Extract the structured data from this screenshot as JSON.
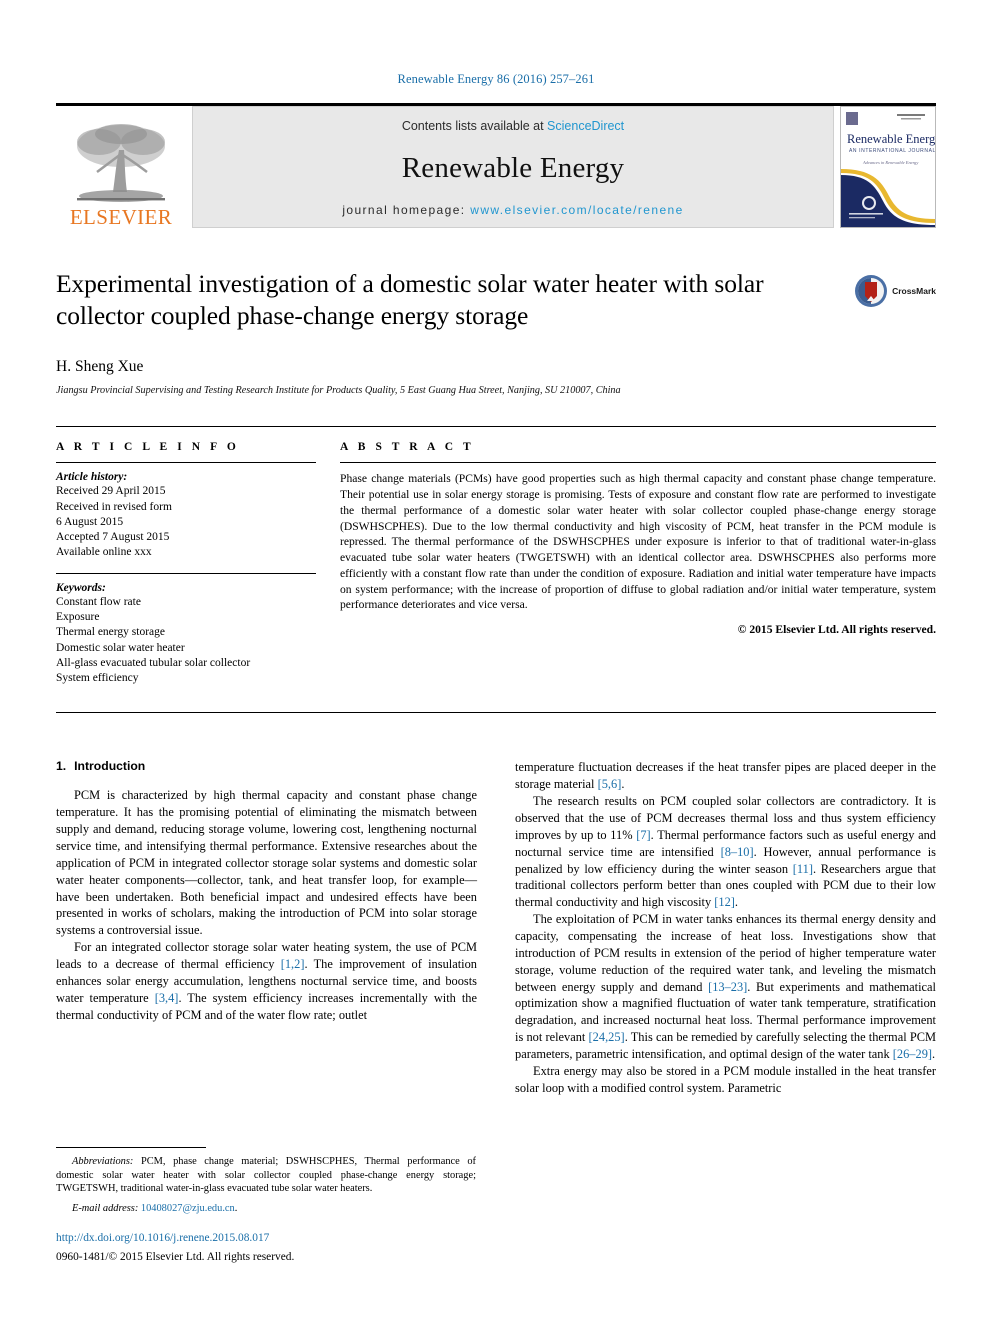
{
  "running_head": "Renewable Energy 86 (2016) 257–261",
  "masthead": {
    "publisher_name": "ELSEVIER",
    "contents_prefix": "Contents lists available at ",
    "contents_link": "ScienceDirect",
    "journal_name": "Renewable Energy",
    "homepage_prefix": "journal homepage: ",
    "homepage_url": "www.elsevier.com/locate/renene",
    "cover_title": "Renewable Energy",
    "cover_subtitle": "AN INTERNATIONAL JOURNAL"
  },
  "article": {
    "title": "Experimental investigation of a domestic solar water heater with solar collector coupled phase-change energy storage",
    "authors": "H. Sheng Xue",
    "affiliation": "Jiangsu Provincial Supervising and Testing Research Institute for Products Quality, 5 East Guang Hua Street, Nanjing, SU 210007, China",
    "crossmark_label": "CrossMark"
  },
  "article_info": {
    "heading": "A R T I C L E  I N F O",
    "history_label": "Article history:",
    "history_lines": [
      "Received 29 April 2015",
      "Received in revised form",
      "6 August 2015",
      "Accepted 7 August 2015",
      "Available online xxx"
    ],
    "keywords_label": "Keywords:",
    "keywords": [
      "Constant flow rate",
      "Exposure",
      "Thermal energy storage",
      "Domestic solar water heater",
      "All-glass evacuated tubular solar collector",
      "System efficiency"
    ]
  },
  "abstract": {
    "heading": "A B S T R A C T",
    "text": "Phase change materials (PCMs) have good properties such as high thermal capacity and constant phase change temperature. Their potential use in solar energy storage is promising. Tests of exposure and constant flow rate are performed to investigate the thermal performance of a domestic solar water heater with solar collector coupled phase-change energy storage (DSWHSCPHES). Due to the low thermal conductivity and high viscosity of PCM, heat transfer in the PCM module is repressed. The thermal performance of the DSWHSCPHES under exposure is inferior to that of traditional water-in-glass evacuated tube solar water heaters (TWGETSWH) with an identical collector area. DSWHSCPHES also performs more efficiently with a constant flow rate than under the condition of exposure. Radiation and initial water temperature have impacts on system performance; with the increase of proportion of diffuse to global radiation and/or initial water temperature, system performance deteriorates and vice versa.",
    "copyright": "© 2015 Elsevier Ltd. All rights reserved."
  },
  "body": {
    "section_number": "1.",
    "section_title": "Introduction",
    "left_paragraphs": [
      "PCM is characterized by high thermal capacity and constant phase change temperature. It has the promising potential of eliminating the mismatch between supply and demand, reducing storage volume, lowering cost, lengthening nocturnal service time, and intensifying thermal performance. Extensive researches about the application of PCM in integrated collector storage solar systems and domestic solar water heater components—collector, tank, and heat transfer loop, for example—have been undertaken. Both beneficial impact and undesired effects have been presented in works of scholars, making the introduction of PCM into solar storage systems a controversial issue."
    ],
    "left_paragraph_2_parts": [
      "For an integrated collector storage solar water heating system, the use of PCM leads to a decrease of thermal efficiency ",
      "[1,2]",
      ". The improvement of insulation enhances solar energy accumulation, lengthens nocturnal service time, and boosts water temperature ",
      "[3,4]",
      ". The system efficiency increases incrementally with the thermal conductivity of PCM and of the water flow rate; outlet"
    ],
    "right_p1_parts": [
      "temperature fluctuation decreases if the heat transfer pipes are placed deeper in the storage material ",
      "[5,6]",
      "."
    ],
    "right_p2_parts": [
      "The research results on PCM coupled solar collectors are contradictory. It is observed that the use of PCM decreases thermal loss and thus system efficiency improves by up to 11% ",
      "[7]",
      ". Thermal performance factors such as useful energy and nocturnal service time are intensified ",
      "[8–10]",
      ". However, annual performance is penalized by low efficiency during the winter season ",
      "[11]",
      ". Researchers argue that traditional collectors perform better than ones coupled with PCM due to their low thermal conductivity and high viscosity ",
      "[12]",
      "."
    ],
    "right_p3_parts": [
      "The exploitation of PCM in water tanks enhances its thermal energy density and capacity, compensating the increase of heat loss. Investigations show that introduction of PCM results in extension of the period of higher temperature water storage, volume reduction of the required water tank, and leveling the mismatch between energy supply and demand ",
      "[13–23]",
      ". But experiments and mathematical optimization show a magnified fluctuation of water tank temperature, stratification degradation, and increased nocturnal heat loss. Thermal performance improvement is not relevant ",
      "[24,25]",
      ". This can be remedied by carefully selecting the thermal PCM parameters, parametric intensification, and optimal design of the water tank ",
      "[26–29]",
      "."
    ],
    "right_p4": "Extra energy may also be stored in a PCM module installed in the heat transfer solar loop with a modified control system. Parametric"
  },
  "footnotes": {
    "abbrev_label": "Abbreviations:",
    "abbrev_text": " PCM, phase change material; DSWHSCPHES, Thermal performance of domestic solar water heater with solar collector coupled phase-change energy storage; TWGETSWH, traditional water-in-glass evacuated tube solar water heaters.",
    "email_label": "E-mail address:",
    "email": "10408027@zju.edu.cn",
    "email_suffix": ".",
    "doi": "http://dx.doi.org/10.1016/j.renene.2015.08.017",
    "issn": "0960-1481/© 2015 Elsevier Ltd. All rights reserved."
  },
  "colors": {
    "link": "#1a6ea8",
    "sciencedirect": "#2196cf",
    "elsevier_orange": "#E87722",
    "masthead_bg": "#e8e8e8"
  }
}
